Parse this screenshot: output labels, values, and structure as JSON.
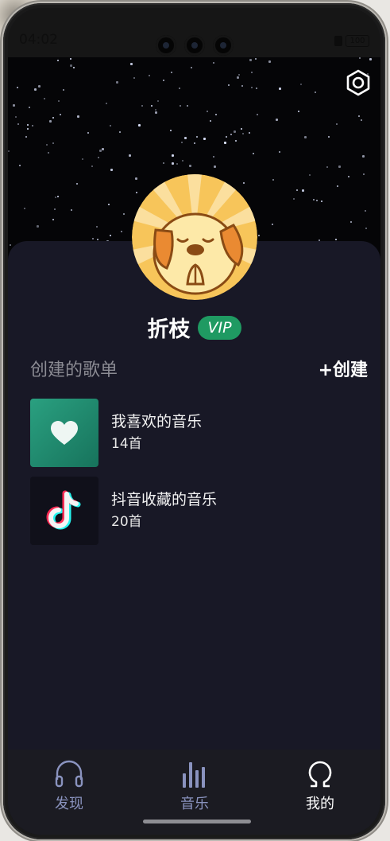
{
  "status_bar": {
    "time": "04:02",
    "battery": "100"
  },
  "profile": {
    "username": "折枝",
    "badge": "VIP"
  },
  "playlists_section": {
    "title": "创建的歌单",
    "create_label": "+创建",
    "items": [
      {
        "name": "我喜欢的音乐",
        "count": "14首",
        "cover_icon": "heart-icon"
      },
      {
        "name": "抖音收藏的音乐",
        "count": "20首",
        "cover_icon": "tiktok-icon"
      }
    ]
  },
  "tabbar": {
    "tabs": [
      {
        "label": "发现",
        "icon": "headphones-icon",
        "active": false
      },
      {
        "label": "音乐",
        "icon": "equalizer-icon",
        "active": false
      },
      {
        "label": "我的",
        "icon": "omega-icon",
        "active": true
      }
    ]
  },
  "colors": {
    "vip_green": "#1f9a62",
    "panel_bg": "#181826",
    "inactive_tab": "#8a93bf"
  }
}
